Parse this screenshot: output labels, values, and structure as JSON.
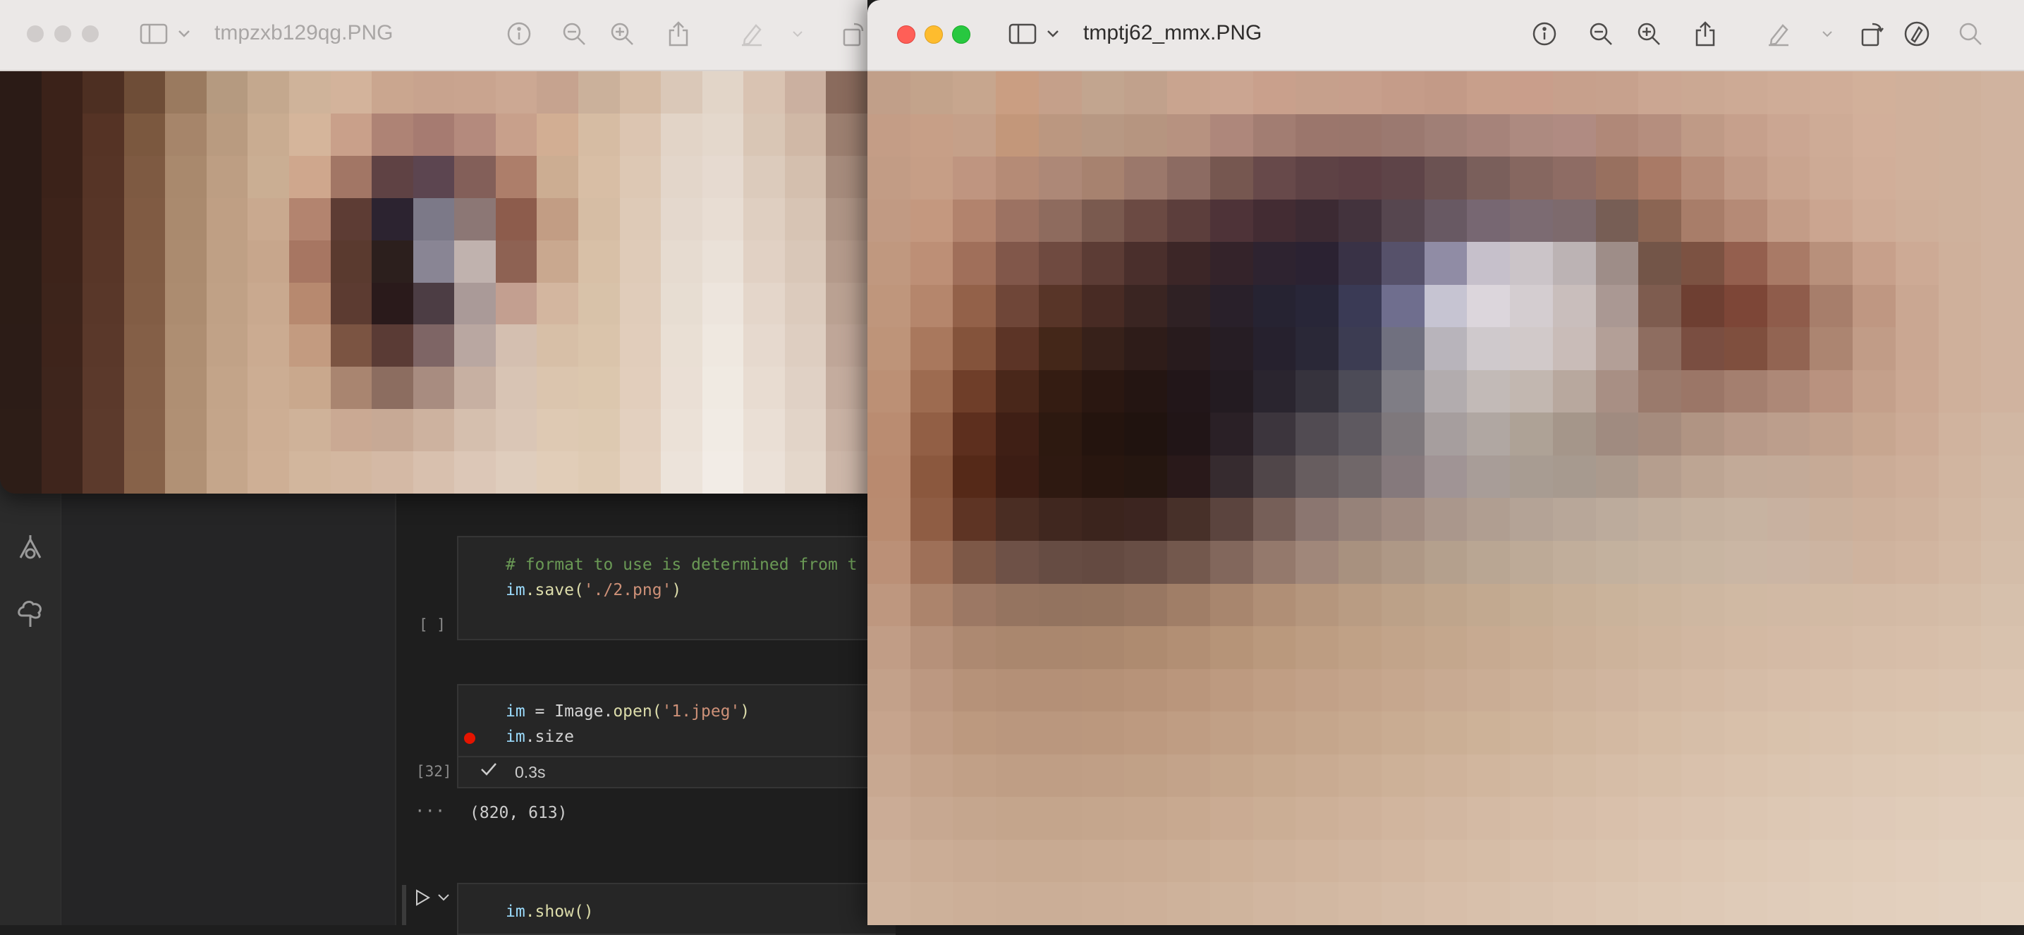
{
  "left_window": {
    "title": "tmpzxb129qg.PNG",
    "grid_cols": 21,
    "grid_rows": 10,
    "pixels": [
      "#2b1b16",
      "#3b2219",
      "#4d2f22",
      "#6e4d37",
      "#9a7a5f",
      "#b59a80",
      "#c4a88e",
      "#cfb39a",
      "#d3b39b",
      "#caa68f",
      "#c8a38e",
      "#c9a48f",
      "#cca893",
      "#c6a38f",
      "#cbb19b",
      "#d5bba5",
      "#dac8b8",
      "#e2d5c8",
      "#d9c3b2",
      "#cbb0a0",
      "#8a6b5d",
      "#2b1b16",
      "#3b2219",
      "#553325",
      "#7b583f",
      "#a6856a",
      "#b99b80",
      "#c9ac91",
      "#d5b59b",
      "#c9a08a",
      "#ae8375",
      "#a67b71",
      "#b48a7d",
      "#c8a08b",
      "#d2ae93",
      "#d6bca3",
      "#dcc5b1",
      "#e2d4c7",
      "#e4d8cc",
      "#d9c6b5",
      "#d0b8a6",
      "#9c7f70",
      "#2b1b16",
      "#3b2219",
      "#563426",
      "#7e5a42",
      "#a9896d",
      "#bd9e83",
      "#caae93",
      "#cfa78d",
      "#a27665",
      "#5f4244",
      "#5c4550",
      "#835f59",
      "#ad7e6a",
      "#ccad92",
      "#d8bea5",
      "#ddc8b4",
      "#e3d6ca",
      "#e6dad0",
      "#dccbbc",
      "#d4bfae",
      "#a68b7c",
      "#2b1b16",
      "#3d231a",
      "#573527",
      "#805b43",
      "#aa8a6e",
      "#bf9f84",
      "#c9a98f",
      "#b3846f",
      "#5d3c34",
      "#2c2330",
      "#7c7988",
      "#8c7775",
      "#8d5c4c",
      "#c29d84",
      "#d6bda4",
      "#decab7",
      "#e4d8cd",
      "#e8ddd3",
      "#dfcfc1",
      "#d7c4b4",
      "#ae9485",
      "#2c1c16",
      "#3d231a",
      "#583628",
      "#815c44",
      "#ab8b6f",
      "#bfa085",
      "#c7a68c",
      "#a77662",
      "#5a3a2f",
      "#2c1f1d",
      "#898594",
      "#c0b2ae",
      "#8e6253",
      "#c9a88f",
      "#d8c0a7",
      "#dfcbb8",
      "#e6dbd0",
      "#eae1d8",
      "#e1d1c4",
      "#d9c7b8",
      "#b49a8b",
      "#2c1c16",
      "#3d241b",
      "#593729",
      "#825d45",
      "#ac8c70",
      "#c0a186",
      "#c9a98f",
      "#b7896f",
      "#5c3b31",
      "#2a1a1b",
      "#4c3d44",
      "#aa9a98",
      "#c39f90",
      "#d3b69f",
      "#d8c2a9",
      "#e0ccba",
      "#e7ddd2",
      "#ede5dd",
      "#e4d6ca",
      "#dccbbd",
      "#baa192",
      "#2c1c17",
      "#3e241b",
      "#5a382a",
      "#845f47",
      "#ae8e72",
      "#c1a287",
      "#cbab91",
      "#c39b80",
      "#7b5442",
      "#5a3b35",
      "#7e6565",
      "#b9a7a1",
      "#d4bfb0",
      "#d7bfa7",
      "#dac4ab",
      "#e1cdbb",
      "#e9dfd4",
      "#efe8e0",
      "#e6d9ce",
      "#decec1",
      "#bfa698",
      "#2c1c17",
      "#3e251c",
      "#5b392b",
      "#856048",
      "#af8f73",
      "#c3a489",
      "#ccad93",
      "#c9a88d",
      "#a98570",
      "#8c6d60",
      "#a88c80",
      "#c7b0a2",
      "#d8c4b4",
      "#dbc5ae",
      "#dcc7ae",
      "#e2cebc",
      "#eadfd5",
      "#f0eae2",
      "#e8dcd1",
      "#e0d1c5",
      "#c4ac9e",
      "#2d1d17",
      "#3f251c",
      "#5c3a2c",
      "#866149",
      "#b09074",
      "#c4a58a",
      "#cdae94",
      "#cfb299",
      "#caa993",
      "#c7a995",
      "#cdb29f",
      "#d5bfae",
      "#dac6b6",
      "#dec9b3",
      "#ddc9b1",
      "#e3d0bf",
      "#ebe1d7",
      "#f1ebe4",
      "#eadfd5",
      "#e2d4c8",
      "#c9b2a4",
      "#2d1d17",
      "#3f251c",
      "#5c3a2c",
      "#876249",
      "#b19175",
      "#c5a68b",
      "#ceaf95",
      "#d2b69d",
      "#d3b7a0",
      "#d4b9a5",
      "#d8c0ae",
      "#dcc7b7",
      "#dfcdbd",
      "#e1cdb8",
      "#dfcbb4",
      "#e4d2c1",
      "#ece3da",
      "#f2ece6",
      "#ebe1d8",
      "#e4d7cb",
      "#cdb7a9"
    ]
  },
  "right_window": {
    "title": "tmptj62_mmx.PNG",
    "grid_cols": 27,
    "grid_rows": 20,
    "pixels": [
      "#c19f89",
      "#c3a38b",
      "#c7a68e",
      "#ca9e82",
      "#c5a08a",
      "#c2a58f",
      "#c1a18c",
      "#c9a48f",
      "#cba591",
      "#c9a08c",
      "#c6a08c",
      "#c79f8c",
      "#c59c89",
      "#c39a87",
      "#c89f8b",
      "#c99e8b",
      "#c7a08c",
      "#c7a18d",
      "#cba692",
      "#cba893",
      "#cdaa95",
      "#cfac97",
      "#d0ad98",
      "#d2b09a",
      "#d0b09b",
      "#cfb19c",
      "#d0b39f",
      "#c49d86",
      "#c79f87",
      "#c5a089",
      "#c3977a",
      "#bb9780",
      "#b79883",
      "#b69580",
      "#b79280",
      "#ae877b",
      "#a27d72",
      "#9b766c",
      "#9a766c",
      "#9b7970",
      "#a07f76",
      "#a6837a",
      "#ad8a80",
      "#b08b82",
      "#b08878",
      "#b58e7e",
      "#bf9a86",
      "#c6a08c",
      "#cba692",
      "#ceab96",
      "#d2af9a",
      "#d0b09b",
      "#cfb19c",
      "#d0b39f",
      "#c29c85",
      "#c69e86",
      "#bf9580",
      "#b58b76",
      "#ad8877",
      "#a7826f",
      "#9b786b",
      "#8c6b62",
      "#765750",
      "#67494a",
      "#5e4245",
      "#5c3f44",
      "#5e4448",
      "#6b5252",
      "#7a5f5b",
      "#866760",
      "#8e6c64",
      "#98705f",
      "#a97a66",
      "#b68c78",
      "#c19a86",
      "#c9a48f",
      "#cdaa95",
      "#d1ae99",
      "#d0b09b",
      "#cfb19c",
      "#d0b39f",
      "#c19a83",
      "#c4987f",
      "#b2836d",
      "#9c7262",
      "#8e6b5e",
      "#7a5a4f",
      "#6b4a43",
      "#5c3e3c",
      "#4e3338",
      "#432c33",
      "#3c2a33",
      "#43333d",
      "#56464f",
      "#685963",
      "#776772",
      "#7c6b72",
      "#7d6a6d",
      "#775e55",
      "#8b6553",
      "#a87d69",
      "#b58a76",
      "#c39c87",
      "#cba590",
      "#cfac97",
      "#cfaf9a",
      "#cfb19c",
      "#d0b39f",
      "#c0987f",
      "#bd8f76",
      "#a06f5a",
      "#81574a",
      "#6f4a40",
      "#5c3c35",
      "#4a2f2c",
      "#3c2627",
      "#34232a",
      "#2e2330",
      "#2b2232",
      "#393246",
      "#56516a",
      "#908ca5",
      "#c6c0cb",
      "#cbc4c8",
      "#bcb3b4",
      "#9e8d88",
      "#735548",
      "#7c5242",
      "#945f4e",
      "#a97a66",
      "#b8907b",
      "#c7a08b",
      "#cdaa95",
      "#cfb09b",
      "#d0b39f",
      "#bf967c",
      "#b5866c",
      "#936149",
      "#6f4638",
      "#583528",
      "#482b24",
      "#3a2522",
      "#2f2124",
      "#29202a",
      "#262332",
      "#282638",
      "#3a3a55",
      "#6f6e8e",
      "#c6c4d2",
      "#dcd6dc",
      "#d4cdd0",
      "#c9bebc",
      "#aa9893",
      "#7e5c4f",
      "#6e3f32",
      "#7d4637",
      "#8f5c4b",
      "#a77e6b",
      "#bf9782",
      "#caa792",
      "#cfb09b",
      "#d0b39f",
      "#be9479",
      "#a9785d",
      "#84533b",
      "#5c3426",
      "#442719",
      "#37211a",
      "#2e1c19",
      "#281b1d",
      "#261d24",
      "#26212e",
      "#2a2837",
      "#3c3c52",
      "#70707f",
      "#b8b4bb",
      "#cfc9cc",
      "#d1c9c9",
      "#c9bcb8",
      "#b39f97",
      "#8e6d60",
      "#7a4e41",
      "#7f4f3e",
      "#926452",
      "#ac8571",
      "#c19c87",
      "#caa792",
      "#cfb09b",
      "#d0b39f",
      "#bc9075",
      "#9d6b50",
      "#6f3e29",
      "#49271a",
      "#341c12",
      "#2a1711",
      "#241512",
      "#221619",
      "#231b21",
      "#2a252f",
      "#36333d",
      "#4c4b57",
      "#7f7d85",
      "#b2acae",
      "#c2bab7",
      "#c2b7b0",
      "#b8a89e",
      "#a88f84",
      "#9a7a6c",
      "#9b7667",
      "#a47f6f",
      "#ad8877",
      "#b9927f",
      "#c4a08b",
      "#cba893",
      "#cfb09b",
      "#d0b39f",
      "#ba8c71",
      "#925f45",
      "#5d2f1e",
      "#3f1f15",
      "#2d1910",
      "#24140e",
      "#20130f",
      "#211517",
      "#2a2026",
      "#3c353d",
      "#514b52",
      "#5e5960",
      "#7e787c",
      "#a69e9e",
      "#b0a7a2",
      "#aea296",
      "#a5968a",
      "#a08b80",
      "#a58b7d",
      "#b09483",
      "#b89a89",
      "#bc9e8c",
      "#c1a18d",
      "#c7a690",
      "#ccab96",
      "#d0b39e",
      "#d1b7a3",
      "#b98a6f",
      "#8b583e",
      "#552918",
      "#3c1d14",
      "#2e1911",
      "#28160f",
      "#251610",
      "#29191a",
      "#362b2f",
      "#504649",
      "#675d5f",
      "#706769",
      "#85797c",
      "#a09495",
      "#a89d98",
      "#a89c92",
      "#a79a8f",
      "#ab9a8d",
      "#b59e8e",
      "#bda593",
      "#c2aa98",
      "#c3aa98",
      "#c6aa96",
      "#cbac97",
      "#ceaf9a",
      "#d1b5a0",
      "#d2b9a5",
      "#b98b70",
      "#8f5d44",
      "#5e3424",
      "#4a2d23",
      "#40271f",
      "#3b241d",
      "#3c2520",
      "#473029",
      "#5b443e",
      "#765f58",
      "#8b7670",
      "#968279",
      "#a08b81",
      "#aa978c",
      "#b09e91",
      "#b4a396",
      "#b8a799",
      "#bcab9c",
      "#c1ae9d",
      "#c5b19f",
      "#c7b3a1",
      "#c8b1a0",
      "#cab09c",
      "#cdb09b",
      "#cfb29d",
      "#d2b7a2",
      "#d3bba7",
      "#bb9077",
      "#9e7058",
      "#7d5847",
      "#6e5147",
      "#664c43",
      "#644a41",
      "#684e45",
      "#73584d",
      "#82675c",
      "#94796c",
      "#a0877a",
      "#a8917f",
      "#ae9886",
      "#b4a08d",
      "#b9a693",
      "#bdaa97",
      "#c1ae9b",
      "#c3b19e",
      "#c6b3a0",
      "#c8b5a2",
      "#cab6a4",
      "#cbb5a4",
      "#ccb4a1",
      "#cfb39e",
      "#d1b5a0",
      "#d3b9a4",
      "#d4bda9",
      "#be977f",
      "#ac846c",
      "#9c7864",
      "#957460",
      "#93735f",
      "#94745f",
      "#987762",
      "#a07e67",
      "#a8866e",
      "#b08f76",
      "#b5967d",
      "#b99c83",
      "#bca188",
      "#bfa58c",
      "#c2a990",
      "#c5ad94",
      "#c8b098",
      "#cab39b",
      "#ccb59e",
      "#ceb7a1",
      "#d0b9a3",
      "#d1b9a4",
      "#d2baa4",
      "#d3baa5",
      "#d4bba6",
      "#d5bda8",
      "#d6c0ac",
      "#c19d86",
      "#b6917a",
      "#ad8971",
      "#aa876e",
      "#aa876e",
      "#ab886e",
      "#ae8b70",
      "#b28f74",
      "#b69478",
      "#ba997d",
      "#bd9d82",
      "#c0a186",
      "#c2a48a",
      "#c4a78d",
      "#c7aa91",
      "#c9ad94",
      "#cbb098",
      "#cdb39b",
      "#cfb59e",
      "#d1b7a1",
      "#d3b9a3",
      "#d4baa5",
      "#d5bba6",
      "#d6bda8",
      "#d7bea9",
      "#d8c0ab",
      "#d8c2ae",
      "#c3a18a",
      "#bc9881",
      "#b69279",
      "#b49077",
      "#b49077",
      "#b59177",
      "#b79379",
      "#ba967c",
      "#bd9a80",
      "#c09e84",
      "#c2a188",
      "#c4a48b",
      "#c6a78e",
      "#c8aa92",
      "#caad95",
      "#ccb098",
      "#ceb39c",
      "#d0b59f",
      "#d2b8a2",
      "#d4baa4",
      "#d5bca7",
      "#d7bea9",
      "#d8bfaa",
      "#d9c1ac",
      "#dac2ad",
      "#dac3af",
      "#dbc5b1",
      "#c6a48d",
      "#c09d85",
      "#bc997f",
      "#ba977e",
      "#ba977e",
      "#bb987e",
      "#bd9a80",
      "#bf9d83",
      "#c1a086",
      "#c3a389",
      "#c5a68c",
      "#c7a98f",
      "#c9ac92",
      "#cbaf95",
      "#cdb298",
      "#cfb49b",
      "#d1b79f",
      "#d3b9a2",
      "#d5bca5",
      "#d6bea8",
      "#d8c0aa",
      "#d9c2ac",
      "#dac3ae",
      "#dbc5b0",
      "#dcc6b1",
      "#dcc8b3",
      "#ddc9b5",
      "#c8a891",
      "#c4a38b",
      "#c1a087",
      "#bf9e85",
      "#bf9e85",
      "#c09f86",
      "#c1a187",
      "#c3a38a",
      "#c5a68c",
      "#c7a98f",
      "#c9ab92",
      "#cbae95",
      "#cdb198",
      "#cfb39b",
      "#d1b69e",
      "#d2b8a1",
      "#d4bba4",
      "#d6bda7",
      "#d7bfa9",
      "#d9c1ac",
      "#dac3ae",
      "#dbc5b0",
      "#dcc6b2",
      "#ddc8b4",
      "#dec9b5",
      "#dfcab7",
      "#dfccb9",
      "#cbac96",
      "#c7a891",
      "#c5a68e",
      "#c4a58c",
      "#c4a58c",
      "#c5a68d",
      "#c6a78e",
      "#c8a990",
      "#caab93",
      "#cbae95",
      "#cdb098",
      "#cfb29b",
      "#d1b59e",
      "#d2b7a1",
      "#d4baa4",
      "#d6bca6",
      "#d7bea9",
      "#d9c0ab",
      "#dac2ae",
      "#dbc4b0",
      "#dcc6b2",
      "#ddc8b4",
      "#dec9b6",
      "#dfcab8",
      "#e0ccb9",
      "#e1cdbb",
      "#e1cebc",
      "#cdb09a",
      "#cbad96",
      "#c9ab94",
      "#c8aa92",
      "#c8aa92",
      "#c9ab93",
      "#caac94",
      "#cbae96",
      "#cdb098",
      "#ceb29b",
      "#d0b49d",
      "#d1b6a0",
      "#d3b8a2",
      "#d5bba5",
      "#d6bda7",
      "#d8bfaa",
      "#d9c1ac",
      "#dac3ae",
      "#dcc5b1",
      "#ddc7b3",
      "#dec9b5",
      "#dfcab7",
      "#e0ccb9",
      "#e1cdba",
      "#e2cebc",
      "#e2d0be",
      "#e3d1bf",
      "#cfb39d",
      "#cdb19a",
      "#ccaf98",
      "#cbae97",
      "#cbae97",
      "#ccaf98",
      "#cdb099",
      "#ceb29b",
      "#cfb49d",
      "#d1b6a0",
      "#d2b8a2",
      "#d4baa4",
      "#d5bca7",
      "#d7bea9",
      "#d8c0ab",
      "#d9c2ae",
      "#dbc4b0",
      "#dcc6b2",
      "#ddc8b4",
      "#dec9b6",
      "#dfcbb8",
      "#e0ccba",
      "#e1cebb",
      "#e2cfbd",
      "#e3d0be",
      "#e3d1c0",
      "#e4d3c2"
    ]
  },
  "editor": {
    "cell1": {
      "comment": "# format to use is determined from t",
      "line2_var": "im",
      "line2_fn": ".save(",
      "line2_str": "'./2.png'",
      "line2_end": ")",
      "exec": "[ ]"
    },
    "cell2": {
      "line1_var": "im",
      "line1_mid": " = Image.",
      "line1_fn": "open(",
      "line1_str": "'1.jpeg'",
      "line1_end": ")",
      "line2_var": "im",
      "line2_rest": ".size",
      "exec": "[32]",
      "status_time": "0.3s",
      "output_more": "···",
      "output_value": "(820, 613)"
    },
    "cell3": {
      "line1_var": "im",
      "line1_fn": ".show()"
    }
  },
  "colors": {
    "close": "#ff5f57",
    "minimize": "#febc2e",
    "zoom": "#28c840",
    "inactive_light": "#d0cccb",
    "check": "#cccccc",
    "breakpoint": "#e51400"
  }
}
